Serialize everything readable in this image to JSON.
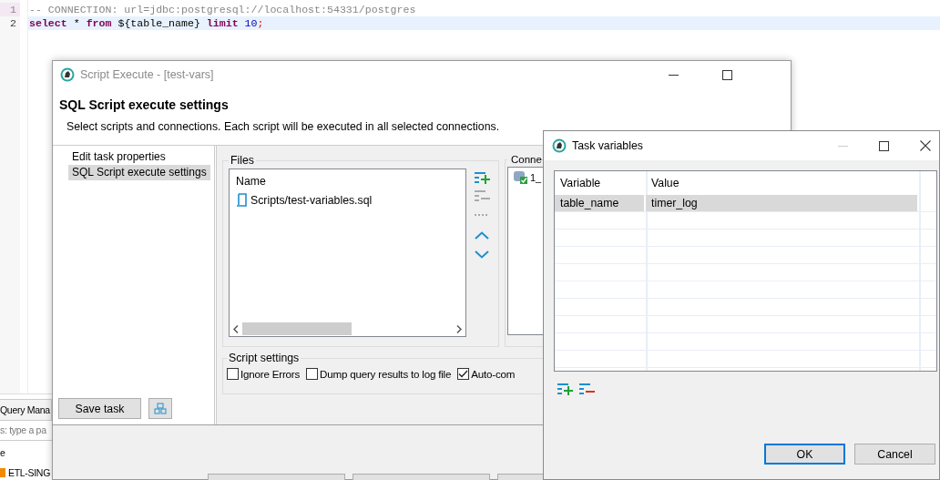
{
  "editor": {
    "lines": [
      {
        "number": "1",
        "current": false,
        "segments": [
          {
            "kind": "comment",
            "text": "-- CONNECTION: url=jdbc:postgresql://localhost:54331/postgres"
          }
        ]
      },
      {
        "number": "2",
        "current": true,
        "segments": [
          {
            "kind": "keyword",
            "text": "select"
          },
          {
            "kind": "plain",
            "text": " * "
          },
          {
            "kind": "keyword",
            "text": "from"
          },
          {
            "kind": "plain",
            "text": " ${table_name} "
          },
          {
            "kind": "keyword",
            "text": "limit"
          },
          {
            "kind": "number",
            "text": " 10"
          },
          {
            "kind": "punct",
            "text": ";"
          }
        ]
      }
    ]
  },
  "side_panel": {
    "tab": "Query Mana",
    "filter": {
      "placeholder": "s: type a pa"
    },
    "items": [
      {
        "label": "e",
        "kind": "header"
      },
      {
        "label": "ETL-SING",
        "kind": "folder"
      }
    ]
  },
  "script_execute": {
    "title": "Script Execute - [test-vars]",
    "heading": "SQL Script execute settings",
    "description": "Select scripts and connections. Each script will be executed in all selected connections.",
    "nav": [
      {
        "label": "Edit task properties",
        "selected": false
      },
      {
        "label": "SQL Script execute settings",
        "selected": true
      }
    ],
    "files": {
      "title": "Files",
      "column": "Name",
      "rows": [
        "Scripts/test-variables.sql"
      ]
    },
    "connections": {
      "title": "Conne",
      "rows": [
        "1_"
      ]
    },
    "script_settings": {
      "title": "Script settings",
      "options": [
        {
          "label": "Ignore Errors",
          "checked": false
        },
        {
          "label": "Dump query results to log file",
          "checked": false
        },
        {
          "label": "Auto-com",
          "checked": true
        }
      ]
    },
    "save_button": "Save task"
  },
  "task_variables": {
    "title": "Task variables",
    "columns": [
      "Variable",
      "Value"
    ],
    "rows": [
      {
        "variable": "table_name",
        "value": "timer_log",
        "selected": true
      }
    ],
    "buttons": [
      {
        "label": "OK",
        "default": true
      },
      {
        "label": "Cancel",
        "default": false
      }
    ]
  }
}
